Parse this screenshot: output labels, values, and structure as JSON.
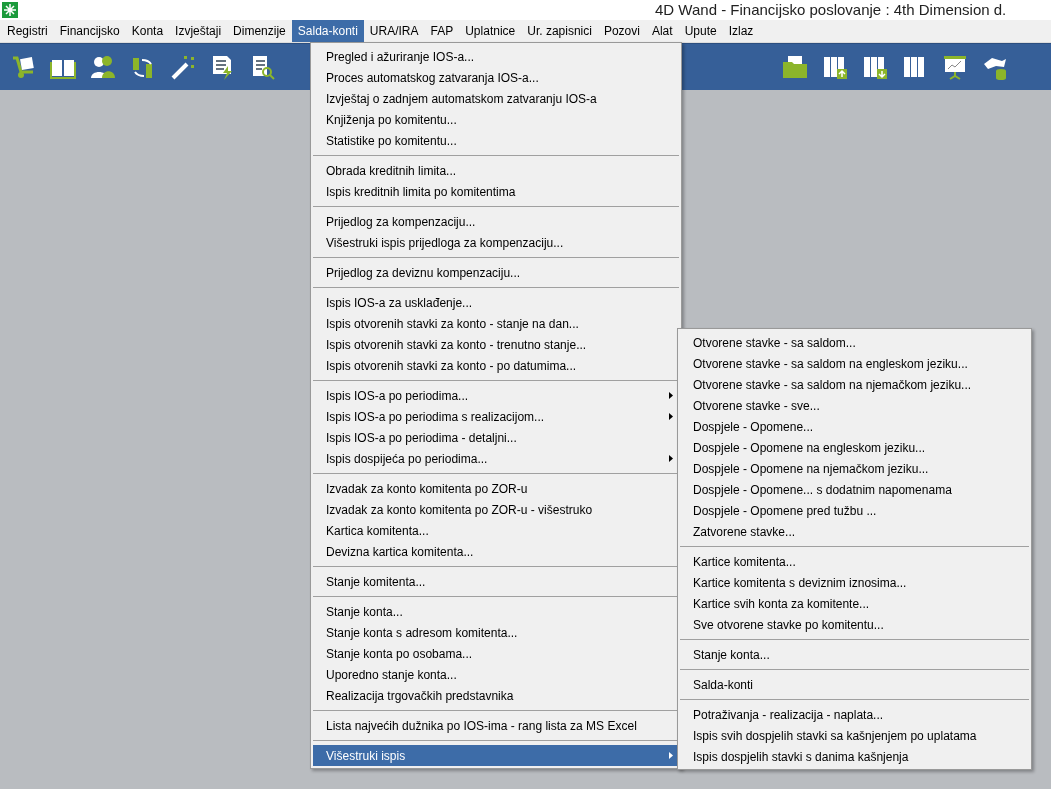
{
  "window": {
    "title": "4D Wand - Financijsko poslovanje : 4th Dimension d."
  },
  "menubar": [
    {
      "label": "Registri",
      "selected": false
    },
    {
      "label": "Financijsko",
      "selected": false
    },
    {
      "label": "Konta",
      "selected": false
    },
    {
      "label": "Izvještaji",
      "selected": false
    },
    {
      "label": "Dimenzije",
      "selected": false
    },
    {
      "label": "Salda-konti",
      "selected": true
    },
    {
      "label": "URA/IRA",
      "selected": false
    },
    {
      "label": "FAP",
      "selected": false
    },
    {
      "label": "Uplatnice",
      "selected": false
    },
    {
      "label": "Ur. zapisnici",
      "selected": false
    },
    {
      "label": "Pozovi",
      "selected": false
    },
    {
      "label": "Alat",
      "selected": false
    },
    {
      "label": "Upute",
      "selected": false
    },
    {
      "label": "Izlaz",
      "selected": false
    }
  ],
  "menu": {
    "groups": [
      [
        {
          "label": "Pregled i ažuriranje IOS-a...",
          "submenu": false,
          "selected": false
        },
        {
          "label": "Proces automatskog zatvaranja IOS-a...",
          "submenu": false,
          "selected": false
        },
        {
          "label": "Izvještaj o zadnjem automatskom zatvaranju IOS-a",
          "submenu": false,
          "selected": false
        },
        {
          "label": "Knjiženja po komitentu...",
          "submenu": false,
          "selected": false
        },
        {
          "label": "Statistike po komitentu...",
          "submenu": false,
          "selected": false
        }
      ],
      [
        {
          "label": "Obrada kreditnih limita...",
          "submenu": false,
          "selected": false
        },
        {
          "label": "Ispis kreditnih limita po komitentima",
          "submenu": false,
          "selected": false
        }
      ],
      [
        {
          "label": "Prijedlog za kompenzaciju...",
          "submenu": false,
          "selected": false
        },
        {
          "label": "Višestruki ispis prijedloga za kompenzaciju...",
          "submenu": false,
          "selected": false
        }
      ],
      [
        {
          "label": "Prijedlog za deviznu kompenzaciju...",
          "submenu": false,
          "selected": false
        }
      ],
      [
        {
          "label": "Ispis IOS-a za usklađenje...",
          "submenu": false,
          "selected": false
        },
        {
          "label": "Ispis otvorenih stavki za konto - stanje na dan...",
          "submenu": false,
          "selected": false
        },
        {
          "label": "Ispis otvorenih stavki za konto - trenutno stanje...",
          "submenu": false,
          "selected": false
        },
        {
          "label": "Ispis otvorenih stavki za konto - po datumima...",
          "submenu": false,
          "selected": false
        }
      ],
      [
        {
          "label": "Ispis IOS-a po periodima...",
          "submenu": true,
          "selected": false
        },
        {
          "label": "Ispis IOS-a po periodima s realizacijom...",
          "submenu": true,
          "selected": false
        },
        {
          "label": "Ispis IOS-a po periodima - detaljni...",
          "submenu": false,
          "selected": false
        },
        {
          "label": "Ispis dospijeća po periodima...",
          "submenu": true,
          "selected": false
        }
      ],
      [
        {
          "label": "Izvadak za konto komitenta po ZOR-u",
          "submenu": false,
          "selected": false
        },
        {
          "label": "Izvadak za konto komitenta po ZOR-u - višestruko",
          "submenu": false,
          "selected": false
        },
        {
          "label": "Kartica komitenta...",
          "submenu": false,
          "selected": false
        },
        {
          "label": "Devizna kartica komitenta...",
          "submenu": false,
          "selected": false
        }
      ],
      [
        {
          "label": "Stanje komitenta...",
          "submenu": false,
          "selected": false
        }
      ],
      [
        {
          "label": "Stanje konta...",
          "submenu": false,
          "selected": false
        },
        {
          "label": "Stanje konta s adresom komitenta...",
          "submenu": false,
          "selected": false
        },
        {
          "label": "Stanje konta po osobama...",
          "submenu": false,
          "selected": false
        },
        {
          "label": "Uporedno stanje konta...",
          "submenu": false,
          "selected": false
        },
        {
          "label": "Realizacija trgovačkih predstavnika",
          "submenu": false,
          "selected": false
        }
      ],
      [
        {
          "label": "Lista najvećih dužnika po IOS-ima - rang lista za MS Excel",
          "submenu": false,
          "selected": false
        }
      ],
      [
        {
          "label": "Višestruki ispis",
          "submenu": true,
          "selected": true
        }
      ]
    ]
  },
  "submenu": {
    "groups": [
      [
        {
          "label": "Otvorene stavke - sa saldom...",
          "submenu": false,
          "selected": false
        },
        {
          "label": "Otvorene stavke - sa saldom na engleskom jeziku...",
          "submenu": false,
          "selected": false
        },
        {
          "label": "Otvorene stavke - sa saldom na njemačkom jeziku...",
          "submenu": false,
          "selected": false
        },
        {
          "label": "Otvorene stavke - sve...",
          "submenu": false,
          "selected": false
        },
        {
          "label": "Dospjele - Opomene...",
          "submenu": false,
          "selected": false
        },
        {
          "label": "Dospjele - Opomene na engleskom jeziku...",
          "submenu": false,
          "selected": false
        },
        {
          "label": "Dospjele - Opomene na njemačkom jeziku...",
          "submenu": false,
          "selected": false
        },
        {
          "label": "Dospjele - Opomene... s dodatnim napomenama",
          "submenu": false,
          "selected": false
        },
        {
          "label": "Dospjele - Opomene pred tužbu ...",
          "submenu": false,
          "selected": false
        },
        {
          "label": "Zatvorene stavke...",
          "submenu": false,
          "selected": false
        }
      ],
      [
        {
          "label": "Kartice komitenta...",
          "submenu": false,
          "selected": false
        },
        {
          "label": "Kartice komitenta s deviznim iznosima...",
          "submenu": false,
          "selected": false
        },
        {
          "label": "Kartice svih konta za komitente...",
          "submenu": false,
          "selected": false
        },
        {
          "label": "Sve otvorene stavke po komitentu...",
          "submenu": false,
          "selected": false
        }
      ],
      [
        {
          "label": "Stanje konta...",
          "submenu": false,
          "selected": false
        }
      ],
      [
        {
          "label": "Salda-konti",
          "submenu": false,
          "selected": false
        }
      ],
      [
        {
          "label": "Potraživanja - realizacija - naplata...",
          "submenu": false,
          "selected": false
        },
        {
          "label": "Ispis svih dospjelih stavki sa kašnjenjem po uplatama",
          "submenu": false,
          "selected": false
        },
        {
          "label": "Ispis dospjelih stavki s danima kašnjenja",
          "submenu": false,
          "selected": false
        }
      ]
    ]
  }
}
